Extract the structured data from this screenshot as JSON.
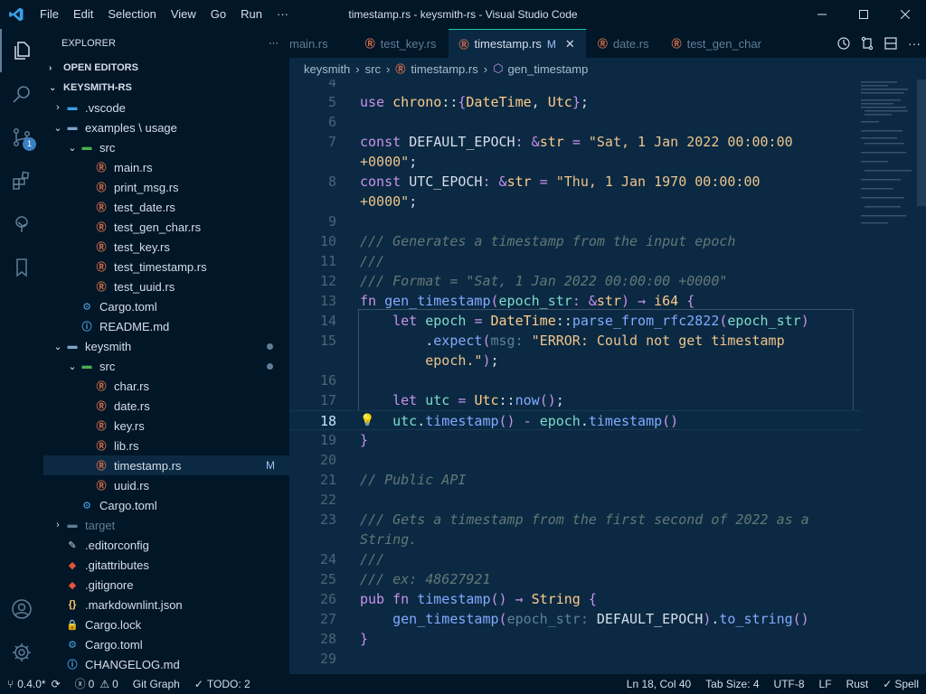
{
  "menu": [
    "File",
    "Edit",
    "Selection",
    "View",
    "Go",
    "Run",
    "···"
  ],
  "window_title": "timestamp.rs - keysmith-rs - Visual Studio Code",
  "activity": {
    "badge": "1"
  },
  "sidebar": {
    "title": "EXPLORER",
    "more": "···",
    "open_editors": "OPEN EDITORS",
    "project": "KEYSMITH-RS",
    "tree": [
      {
        "label": ".vscode",
        "depth": 1,
        "kind": "folder-vscode",
        "chev": "›"
      },
      {
        "label": "examples \\ usage",
        "depth": 1,
        "kind": "folder",
        "chev": "⌄"
      },
      {
        "label": "src",
        "depth": 2,
        "kind": "folder-src",
        "chev": "⌄"
      },
      {
        "label": "main.rs",
        "depth": 3,
        "kind": "rust"
      },
      {
        "label": "print_msg.rs",
        "depth": 3,
        "kind": "rust"
      },
      {
        "label": "test_date.rs",
        "depth": 3,
        "kind": "rust"
      },
      {
        "label": "test_gen_char.rs",
        "depth": 3,
        "kind": "rust"
      },
      {
        "label": "test_key.rs",
        "depth": 3,
        "kind": "rust"
      },
      {
        "label": "test_timestamp.rs",
        "depth": 3,
        "kind": "rust"
      },
      {
        "label": "test_uuid.rs",
        "depth": 3,
        "kind": "rust"
      },
      {
        "label": "Cargo.toml",
        "depth": 2,
        "kind": "gear"
      },
      {
        "label": "README.md",
        "depth": 2,
        "kind": "info"
      },
      {
        "label": "keysmith",
        "depth": 1,
        "kind": "folder",
        "chev": "⌄",
        "dot": true
      },
      {
        "label": "src",
        "depth": 2,
        "kind": "folder-src",
        "chev": "⌄",
        "dot": true
      },
      {
        "label": "char.rs",
        "depth": 3,
        "kind": "rust"
      },
      {
        "label": "date.rs",
        "depth": 3,
        "kind": "rust"
      },
      {
        "label": "key.rs",
        "depth": 3,
        "kind": "rust"
      },
      {
        "label": "lib.rs",
        "depth": 3,
        "kind": "rust"
      },
      {
        "label": "timestamp.rs",
        "depth": 3,
        "kind": "rust",
        "selected": true,
        "mod": "M"
      },
      {
        "label": "uuid.rs",
        "depth": 3,
        "kind": "rust"
      },
      {
        "label": "Cargo.toml",
        "depth": 2,
        "kind": "gear"
      },
      {
        "label": "target",
        "depth": 1,
        "kind": "folder-dim",
        "chev": "›"
      },
      {
        "label": ".editorconfig",
        "depth": 1,
        "kind": "editorconfig"
      },
      {
        "label": ".gitattributes",
        "depth": 1,
        "kind": "git"
      },
      {
        "label": ".gitignore",
        "depth": 1,
        "kind": "git"
      },
      {
        "label": ".markdownlint.json",
        "depth": 1,
        "kind": "json"
      },
      {
        "label": "Cargo.lock",
        "depth": 1,
        "kind": "lock"
      },
      {
        "label": "Cargo.toml",
        "depth": 1,
        "kind": "gear"
      },
      {
        "label": "CHANGELOG.md",
        "depth": 1,
        "kind": "info"
      }
    ]
  },
  "tabs": [
    {
      "label": "main.rs",
      "active": false
    },
    {
      "label": "test_key.rs",
      "active": false
    },
    {
      "label": "timestamp.rs",
      "active": true,
      "tag": "M",
      "close": "✕"
    },
    {
      "label": "date.rs",
      "active": false
    },
    {
      "label": "test_gen_char",
      "active": false
    }
  ],
  "breadcrumb": [
    "keysmith",
    "src",
    "timestamp.rs",
    "gen_timestamp"
  ],
  "editor": {
    "current_line": 18,
    "lines": [
      {
        "n": "4",
        "html": ""
      },
      {
        "n": "5",
        "html": "<span class='kw'>use</span> <span class='ty'>chrono</span><span class='var'>::</span><span class='op'>{</span><span class='ty'>DateTime</span><span class='var'>, </span><span class='ty'>Utc</span><span class='op'>}</span><span class='var'>;</span>"
      },
      {
        "n": "6",
        "html": ""
      },
      {
        "n": "7",
        "html": "<span class='kw'>const</span> <span class='var'>DEFAULT_EPOCH</span><span class='op'>:</span> <span class='op'>&amp;</span><span class='ty'>str</span> <span class='op'>=</span> <span class='str'>\"Sat, 1 Jan 2022 00:00:00</span>"
      },
      {
        "n": "",
        "html": "<span class='str'>+0000\"</span><span class='var'>;</span>"
      },
      {
        "n": "8",
        "html": "<span class='kw'>const</span> <span class='var'>UTC_EPOCH</span><span class='op'>:</span> <span class='op'>&amp;</span><span class='ty'>str</span> <span class='op'>=</span> <span class='str'>\"Thu, 1 Jan 1970 00:00:00</span>"
      },
      {
        "n": "",
        "html": "<span class='str'>+0000\"</span><span class='var'>;</span>"
      },
      {
        "n": "9",
        "html": ""
      },
      {
        "n": "10",
        "html": "<span class='cm'>/// Generates a timestamp from the input epoch</span>"
      },
      {
        "n": "11",
        "html": "<span class='cm'>///</span>"
      },
      {
        "n": "12",
        "html": "<span class='cm'>/// Format = \"Sat, 1 Jan 2022 00:00:00 +0000\"</span>"
      },
      {
        "n": "13",
        "html": "<span class='kw'>fn</span> <span class='fn'>gen_timestamp</span><span class='op'>(</span><span class='param'>epoch_str</span><span class='op'>:</span> <span class='op'>&amp;</span><span class='ty'>str</span><span class='op'>)</span> <span class='op'>→</span> <span class='ty'>i64</span> <span class='op'>{</span>"
      },
      {
        "n": "14",
        "html": "    <span class='kw'>let</span> <span class='param'>epoch</span> <span class='op'>=</span> <span class='ty'>DateTime</span><span class='var'>::</span><span class='fn'>parse_from_rfc2822</span><span class='op'>(</span><span class='param'>epoch_str</span><span class='op'>)</span>"
      },
      {
        "n": "15",
        "html": "        <span class='var'>.</span><span class='fn'>expect</span><span class='op'>(</span><span class='hint'>msg:</span> <span class='str'>\"ERROR: Could not get timestamp</span>"
      },
      {
        "n": "",
        "html": "        <span class='str'>epoch.\"</span><span class='op'>)</span><span class='var'>;</span>"
      },
      {
        "n": "16",
        "html": ""
      },
      {
        "n": "17",
        "html": "    <span class='kw'>let</span> <span class='param'>utc</span> <span class='op'>=</span> <span class='ty'>Utc</span><span class='var'>::</span><span class='fn'>now</span><span class='op'>()</span><span class='var'>;</span>"
      },
      {
        "n": "18",
        "html": "    <span class='param'>utc</span><span class='var'>.</span><span class='fn'>timestamp</span><span class='op'>()</span> <span class='op'>-</span> <span class='param'>epoch</span><span class='var'>.</span><span class='fn'>timestamp</span><span class='op'>()</span>"
      },
      {
        "n": "19",
        "html": "<span class='op'>}</span>"
      },
      {
        "n": "20",
        "html": ""
      },
      {
        "n": "21",
        "html": "<span class='cm'>// Public API</span>"
      },
      {
        "n": "22",
        "html": ""
      },
      {
        "n": "23",
        "html": "<span class='cm'>/// Gets a timestamp from the first second of 2022 as a</span>"
      },
      {
        "n": "",
        "html": "<span class='cm'>String.</span>"
      },
      {
        "n": "24",
        "html": "<span class='cm'>///</span>"
      },
      {
        "n": "25",
        "html": "<span class='cm'>/// ex: 48627921</span>"
      },
      {
        "n": "26",
        "html": "<span class='kw'>pub</span> <span class='kw'>fn</span> <span class='fn'>timestamp</span><span class='op'>()</span> <span class='op'>→</span> <span class='ty'>String</span> <span class='op'>{</span>"
      },
      {
        "n": "27",
        "html": "    <span class='fn'>gen_timestamp</span><span class='op'>(</span><span class='hint'>epoch_str:</span> <span class='var'>DEFAULT_EPOCH</span><span class='op'>)</span><span class='var'>.</span><span class='fn'>to_string</span><span class='op'>()</span>"
      },
      {
        "n": "28",
        "html": "<span class='op'>}</span>"
      },
      {
        "n": "29",
        "html": ""
      }
    ]
  },
  "status": {
    "branch": "0.4.0*",
    "errors": "0",
    "warnings": "0",
    "git_graph": "Git Graph",
    "todo": "TODO: 2",
    "position": "Ln 18, Col 40",
    "tab_size": "Tab Size: 4",
    "encoding": "UTF-8",
    "eol": "LF",
    "language": "Rust",
    "spell": "Spell"
  }
}
